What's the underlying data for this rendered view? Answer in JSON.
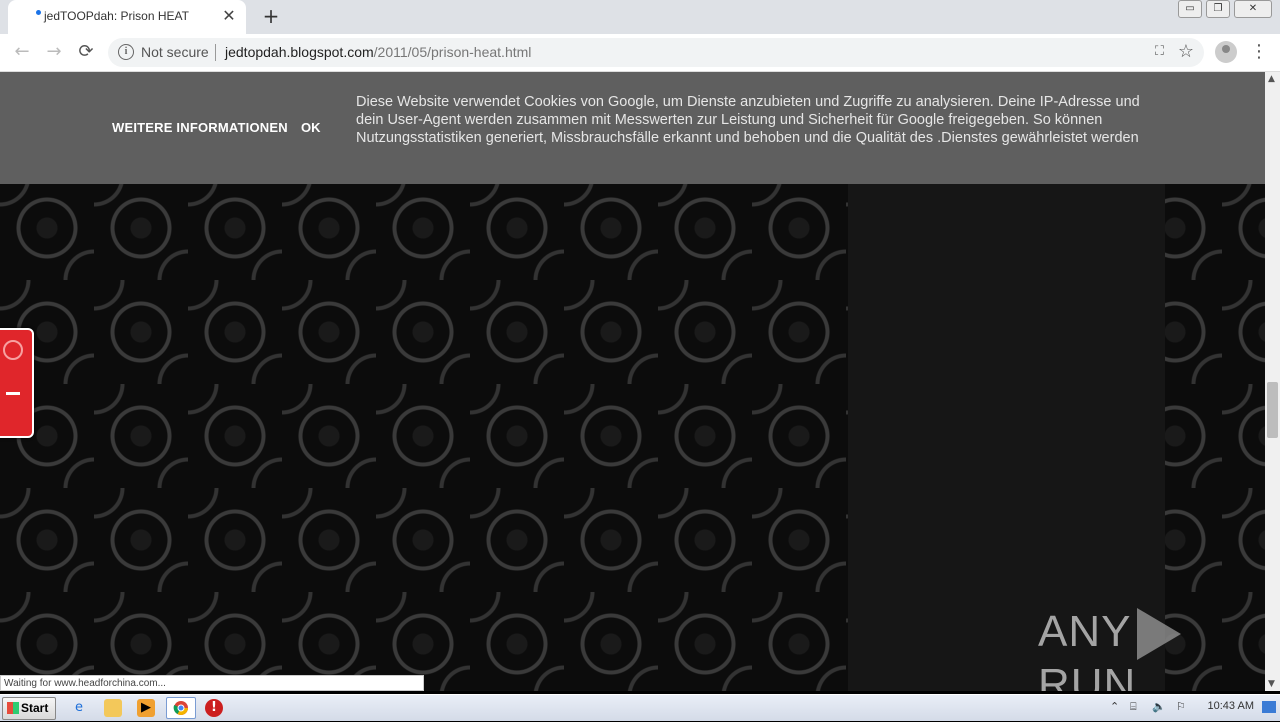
{
  "browser": {
    "tab_title": "jedTOOPdah: Prison HEAT",
    "tab_close": "✕",
    "new_tab": "+",
    "window_buttons": {
      "minimize": "▭",
      "restore": "❐",
      "close": "✕"
    }
  },
  "toolbar": {
    "back": "←",
    "forward": "→",
    "reload": "⟳",
    "security_icon": "i",
    "security_label": "Not secure",
    "url_host": "jedtopdah.blogspot.com",
    "url_path": "/2011/05/prison-heat.html",
    "translate_icon": "⛶",
    "star_icon": "☆",
    "menu_icon": "⋮"
  },
  "cookie_banner": {
    "more_info": "WEITERE INFORMATIONEN",
    "ok": "OK",
    "message": "Diese Website verwendet Cookies von Google, um Dienste anzubieten und Zugriffe zu analysieren. Deine IP-Adresse und dein User-Agent werden zusammen mit Messwerten zur Leistung und Sicherheit für Google freigegeben. So können Nutzungsstatistiken generiert, Missbrauchsfälle erkannt und behoben und die Qualität des .Dienstes gewährleistet werden"
  },
  "watermark": {
    "left": "ANY",
    "right": "RUN"
  },
  "status_text": "Waiting for www.headforchina.com...",
  "scrollbar": {
    "up": "▲",
    "down": "▼"
  },
  "taskbar": {
    "start": "Start",
    "clock": "10:43 AM",
    "tray_icons": [
      "⌃",
      "⌸",
      "🔈",
      "⚐"
    ]
  }
}
